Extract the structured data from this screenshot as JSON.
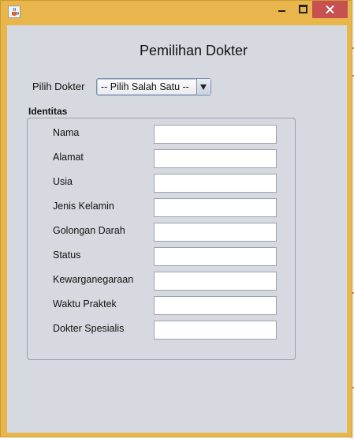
{
  "window": {
    "title": "",
    "icon": "java-cup-icon"
  },
  "header": {
    "title": "Pemilihan Dokter"
  },
  "selector": {
    "label": "Pilih Dokter",
    "value": "-- Pilih Salah Satu --"
  },
  "identity": {
    "title": "Identitas",
    "fields": [
      {
        "label": "Nama",
        "value": ""
      },
      {
        "label": "Alamat",
        "value": ""
      },
      {
        "label": "Usia",
        "value": ""
      },
      {
        "label": "Jenis Kelamin",
        "value": ""
      },
      {
        "label": "Golongan Darah",
        "value": ""
      },
      {
        "label": "Status",
        "value": ""
      },
      {
        "label": "Kewarganegaraan",
        "value": ""
      },
      {
        "label": "Waktu Praktek",
        "value": ""
      },
      {
        "label": "Dokter Spesialis",
        "value": ""
      }
    ]
  },
  "colors": {
    "frame": "#e8b64a",
    "content": "#d6d9df",
    "close": "#c75050"
  }
}
